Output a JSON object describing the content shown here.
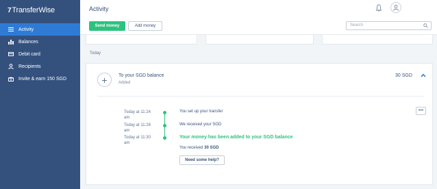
{
  "sidebar": {
    "brand": "TransferWise",
    "brand_mark": "7",
    "items": [
      {
        "label": "Activity",
        "icon": "list-icon",
        "active": true
      },
      {
        "label": "Balances",
        "icon": "bar-chart-icon",
        "active": false
      },
      {
        "label": "Debit card",
        "icon": "card-icon",
        "active": false
      },
      {
        "label": "Recipients",
        "icon": "people-icon",
        "active": false
      },
      {
        "label": "Invite & earn 150 SGD",
        "icon": "gift-icon",
        "active": false
      }
    ]
  },
  "header": {
    "title": "Activity"
  },
  "toolbar": {
    "send_label": "Send money",
    "add_label": "Add money",
    "search_placeholder": "Search"
  },
  "section_label": "Today",
  "transaction": {
    "title": "To your SGD balance",
    "status": "Added",
    "amount": "30 SGD",
    "timeline": [
      {
        "time": "Today at 11:24 am",
        "text": "You set up your transfer"
      },
      {
        "time": "Today at 11:28 am",
        "text": "We received your SGD"
      },
      {
        "time": "Today at 11:30 am",
        "text": "Your money has been added to your SGD balance"
      }
    ],
    "received_prefix": "You received",
    "received_amount": "30 SGD",
    "help_label": "Need some help?",
    "more_label": "•••"
  },
  "colors": {
    "sidebar": "#34517e",
    "active": "#2e7bd6",
    "accent_green": "#2ec27e"
  }
}
